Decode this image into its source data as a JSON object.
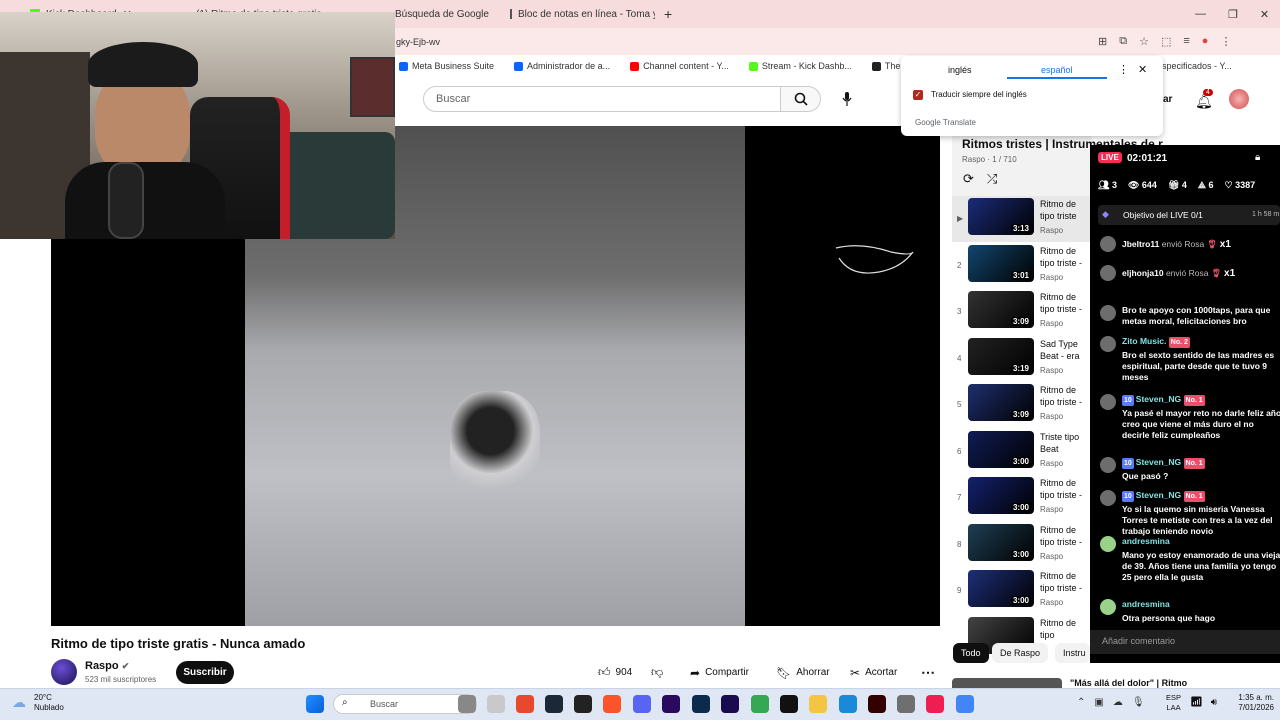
{
  "browser": {
    "tabs": [
      {
        "label": "Kick Dashboard"
      },
      {
        "label": "(1) Ritmo de tipo triste gratis - Nu"
      },
      {
        "label": "Búsqueda de Google"
      },
      {
        "label": "Bloc de notas en línea - Toma y"
      }
    ],
    "url_fragment": "gky-Ejb-wv",
    "bookmarks": [
      "Meta Business Suite",
      "Administrador de a...",
      "Channel content - Y...",
      "Stream - Kick Dashb...",
      "The best ChatBot a...",
      "specificados - Y..."
    ]
  },
  "translate_popup": {
    "lang_from": "inglés",
    "lang_to": "español",
    "checkbox_label": "Traducir siempre del inglés",
    "brand": "Google Translate"
  },
  "youtube": {
    "search_placeholder": "Buscar",
    "notification_count": "4",
    "video": {
      "title": "Ritmo de tipo triste gratis - Nunca amado",
      "channel": "Raspo",
      "subscribers": "523 mil suscriptores",
      "subscribe_label": "Suscribir",
      "likes": "904",
      "share_label": "Compartir",
      "save_label": "Ahorrar",
      "clip_label": "Acortar"
    },
    "playlist": {
      "title": "Ritmos tristes | Instrumentales de r",
      "meta": "Raspo · 1 / 710",
      "items": [
        {
          "num": "▶",
          "title": "Ritmo de tipo triste gratis - Nunca amado",
          "channel": "Raspo",
          "duration": "3:13"
        },
        {
          "num": "2",
          "title": "Ritmo de tipo triste - Peor amor",
          "channel": "Raspo",
          "duration": "3:01"
        },
        {
          "num": "3",
          "title": "Ritmo de tipo triste - Mentiste",
          "channel": "Raspo",
          "duration": "3:09"
        },
        {
          "num": "4",
          "title": "Sad Type Beat - era",
          "channel": "Raspo",
          "duration": "3:19"
        },
        {
          "num": "5",
          "title": "Ritmo de tipo triste - odio a mi m",
          "channel": "Raspo",
          "duration": "3:09"
        },
        {
          "num": "6",
          "title": "Triste tipo Beat",
          "channel": "Raspo",
          "duration": "3:00"
        },
        {
          "num": "7",
          "title": "Ritmo de tipo triste - Victima",
          "channel": "Raspo",
          "duration": "3:00"
        },
        {
          "num": "8",
          "title": "Ritmo de tipo triste - Depresión",
          "channel": "Raspo",
          "duration": "3:00"
        },
        {
          "num": "9",
          "title": "Ritmo de tipo triste - Pensar dem",
          "channel": "Raspo",
          "duration": "3:00"
        },
        {
          "num": "",
          "title": "Ritmo de tipo",
          "channel": "",
          "duration": ""
        }
      ]
    },
    "chips": [
      "Todo",
      "De Raspo",
      "Instru"
    ],
    "next_title": "\"Más allá del dolor\" | Ritmo"
  },
  "live": {
    "badge": "LIVE",
    "timer": "02:01:21",
    "stats": {
      "guests": "3",
      "viewers": "644",
      "gifts": "4",
      "shares": "6",
      "likes": "3387"
    },
    "goal_label": "Objetivo del LIVE 0/1",
    "goal_time": "1 h 58 m",
    "gifts": [
      {
        "user": "Jbeltro11",
        "text": "envió Rosa",
        "count": "x1"
      },
      {
        "user": "eljhonja10",
        "text": "envió Rosa",
        "count": "x1"
      }
    ],
    "messages": [
      {
        "name": "",
        "badges": [],
        "text": "Bro te apoyo con 1000taps, para que metas moral, felicitaciones bro"
      },
      {
        "name": "Zito Music.",
        "badges": [
          "No. 2"
        ],
        "text": "Bro el sexto sentido de las madres es espiritual, parte desde que te tuvo 9 meses"
      },
      {
        "name": "Steven_NG",
        "badges": [
          "10",
          "No. 1"
        ],
        "text": "Ya pasé el mayor reto no darle feliz año creo que viene el más duro el no decirle feliz cumpleaños"
      },
      {
        "name": "Steven_NG",
        "badges": [
          "10",
          "No. 1"
        ],
        "text": "Que pasó ?"
      },
      {
        "name": "Steven_NG",
        "badges": [
          "10",
          "No. 1"
        ],
        "text": "Yo si la quemo sin miseria Vanessa Torres te metiste con tres a la vez del trabajo teniendo novio"
      },
      {
        "name": "andresmina",
        "badges": [],
        "text": "Mano yo estoy enamorado de una vieja de 39. Años tiene una familia yo tengo 25 pero ella le gusta"
      },
      {
        "name": "andresmina",
        "badges": [],
        "text": "Otra persona que hago"
      }
    ],
    "input_placeholder": "Añadir comentario"
  },
  "taskbar": {
    "weather_temp": "20°C",
    "weather_desc": "Nublado",
    "search": "Buscar",
    "lang1": "ESP",
    "lang2": "LAA",
    "time": "1:35 a. m.",
    "date": "7/01/2026"
  },
  "colors": {
    "youtube_red": "#ff0000",
    "tiktok_live": "#fe2c55",
    "chat_name": "#7fe3e3"
  }
}
